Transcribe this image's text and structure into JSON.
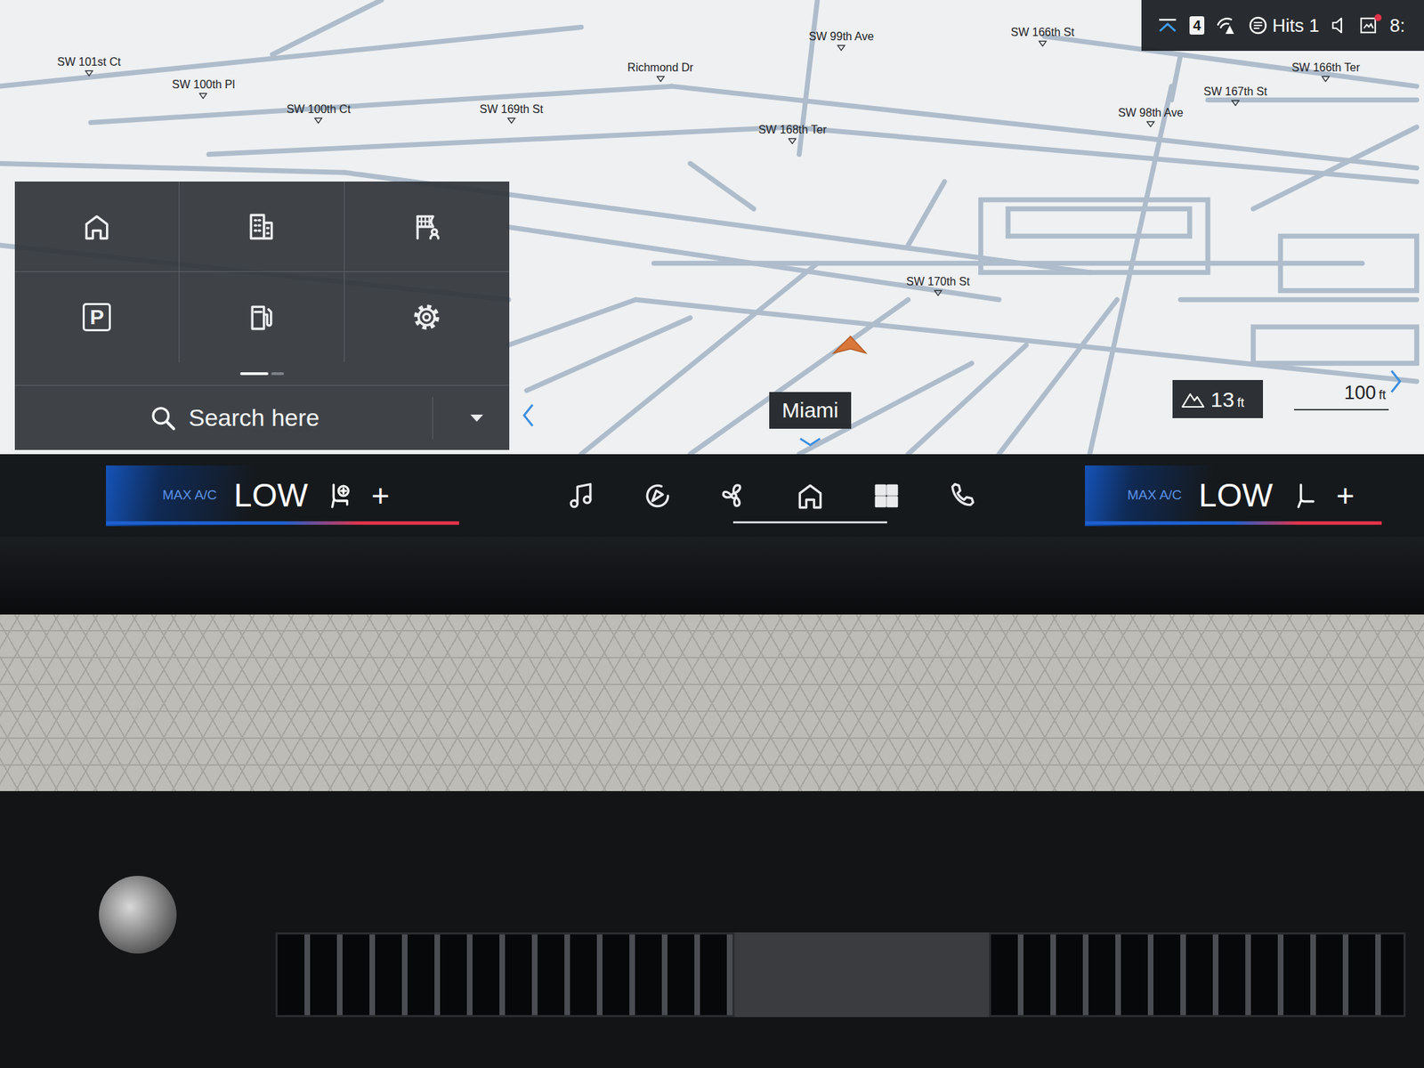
{
  "status_bar": {
    "badge": "4",
    "station": "Hits 1",
    "time": "8:",
    "notification": true
  },
  "map": {
    "street_labels": [
      "SW 101st Ct",
      "SW 100th Pl",
      "SW 100th Ct",
      "SW 169th St",
      "Richmond Dr",
      "SW 99th Ave",
      "SW 166th St",
      "SW 168th Ter",
      "SW 166th Ter",
      "SW 167th St",
      "SW 98th Ave",
      "SW 170th St"
    ],
    "city": "Miami",
    "elevation": {
      "value": "13",
      "unit": "ft"
    },
    "scale": {
      "value": "100",
      "unit": "ft"
    }
  },
  "quick_panel": {
    "shortcuts": [
      {
        "kind": "home"
      },
      {
        "kind": "work"
      },
      {
        "kind": "destination"
      },
      {
        "kind": "parking",
        "label": "P"
      },
      {
        "kind": "fuel"
      },
      {
        "kind": "settings"
      }
    ],
    "pages": [
      {
        "selected": true
      },
      {
        "selected": false
      }
    ],
    "search_label": "Search here"
  },
  "climate": [
    {
      "kind": "driver",
      "max_ac": "MAX A/C",
      "temperature": "LOW",
      "plus": "+"
    },
    {
      "kind": "passenger",
      "max_ac": "MAX A/C",
      "temperature": "LOW",
      "plus": "+"
    }
  ],
  "dock": [
    {
      "kind": "media",
      "selected": false
    },
    {
      "kind": "navigation",
      "selected": false
    },
    {
      "kind": "climate",
      "selected": false
    },
    {
      "kind": "home",
      "selected": true
    },
    {
      "kind": "apps",
      "selected": false
    },
    {
      "kind": "phone",
      "selected": false
    }
  ]
}
